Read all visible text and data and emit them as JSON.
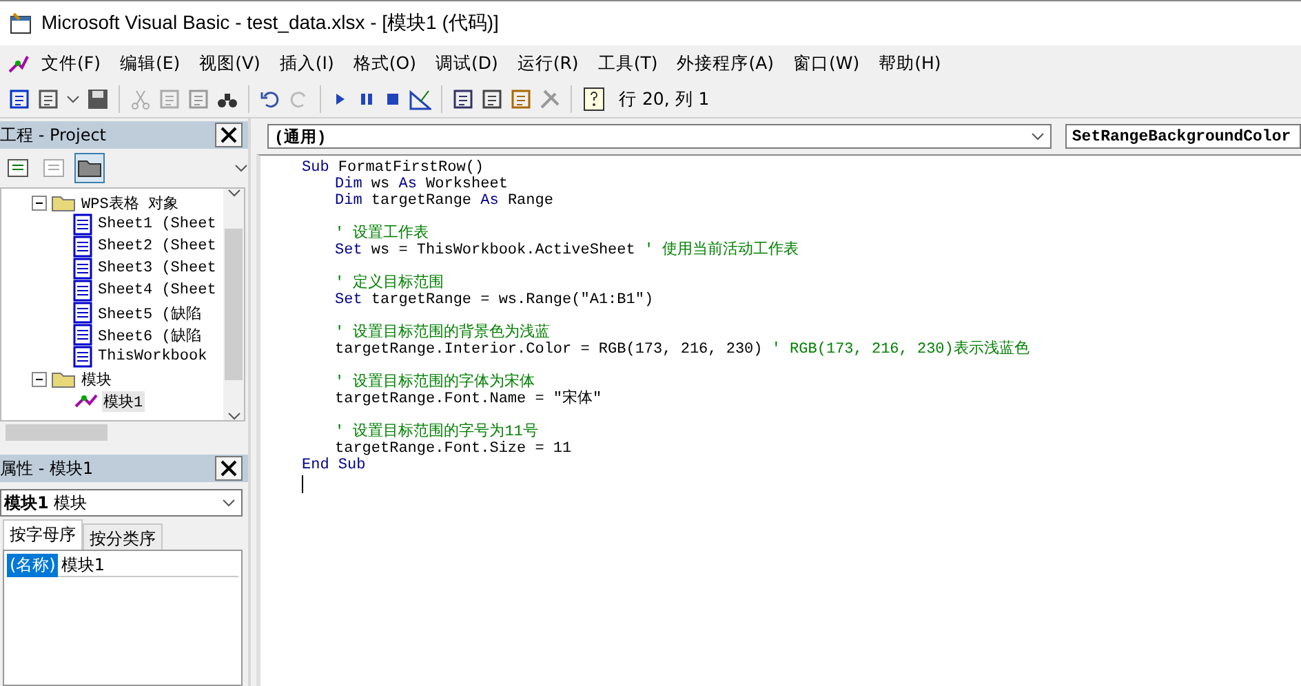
{
  "window": {
    "title": "Microsoft Visual Basic - test_data.xlsx - [模块1 (代码)]"
  },
  "menu": [
    "文件(F)",
    "编辑(E)",
    "视图(V)",
    "插入(I)",
    "格式(O)",
    "调试(D)",
    "运行(R)",
    "工具(T)",
    "外接程序(A)",
    "窗口(W)",
    "帮助(H)"
  ],
  "toolbar": {
    "position": "行 20, 列 1"
  },
  "project": {
    "title": "工程 - Project",
    "tree": [
      {
        "kind": "folder",
        "label": "WPS表格 对象",
        "expanded": true,
        "selected": false,
        "children": [
          {
            "kind": "sheet",
            "label": "Sheet1 (Sheet",
            "selected": false
          },
          {
            "kind": "sheet",
            "label": "Sheet2 (Sheet",
            "selected": false
          },
          {
            "kind": "sheet",
            "label": "Sheet3 (Sheet",
            "selected": false
          },
          {
            "kind": "sheet",
            "label": "Sheet4 (Sheet",
            "selected": false
          },
          {
            "kind": "sheet",
            "label": "Sheet5 (缺陷",
            "selected": false
          },
          {
            "kind": "sheet",
            "label": "Sheet6 (缺陷",
            "selected": false
          },
          {
            "kind": "sheet",
            "label": "ThisWorkbook",
            "selected": false
          }
        ]
      },
      {
        "kind": "folder",
        "label": "模块",
        "expanded": true,
        "selected": false,
        "children": [
          {
            "kind": "module",
            "label": "模块1",
            "selected": true
          }
        ]
      }
    ]
  },
  "properties": {
    "title": "属性 - 模块1",
    "object": "**模块1** 模块",
    "tabs": [
      {
        "label": "按字母序",
        "selected": true
      },
      {
        "label": "按分类序",
        "selected": false
      }
    ],
    "rows": [
      {
        "name": "(名称)",
        "value": "模块1",
        "selected": true
      }
    ]
  },
  "editor": {
    "object": "(通用)",
    "procedure": "SetRangeBackgroundColor",
    "lines": [
      {
        "indented": false,
        "gap_before": false,
        "segments": [
          {
            "kind": "keyword",
            "text": "Sub"
          },
          {
            "kind": "plain",
            "text": " FormatFirstRow()"
          }
        ]
      },
      {
        "indented": true,
        "gap_before": false,
        "segments": [
          {
            "kind": "keyword",
            "text": "Dim"
          },
          {
            "kind": "plain",
            "text": " ws "
          },
          {
            "kind": "keyword",
            "text": "As"
          },
          {
            "kind": "plain",
            "text": " Worksheet"
          }
        ]
      },
      {
        "indented": true,
        "gap_before": false,
        "segments": [
          {
            "kind": "keyword",
            "text": "Dim"
          },
          {
            "kind": "plain",
            "text": " targetRange "
          },
          {
            "kind": "keyword",
            "text": "As"
          },
          {
            "kind": "plain",
            "text": " Range"
          }
        ]
      },
      {
        "indented": true,
        "gap_before": true,
        "segments": [
          {
            "kind": "comment",
            "text": "' 设置工作表"
          }
        ]
      },
      {
        "indented": true,
        "gap_before": false,
        "segments": [
          {
            "kind": "keyword",
            "text": "Set"
          },
          {
            "kind": "plain",
            "text": " ws = ThisWorkbook.ActiveSheet "
          },
          {
            "kind": "comment",
            "text": "' 使用当前活动工作表"
          }
        ]
      },
      {
        "indented": true,
        "gap_before": true,
        "segments": [
          {
            "kind": "comment",
            "text": "' 定义目标范围"
          }
        ]
      },
      {
        "indented": true,
        "gap_before": false,
        "segments": [
          {
            "kind": "keyword",
            "text": "Set"
          },
          {
            "kind": "plain",
            "text": " targetRange = ws.Range(\"A1:B1\")"
          }
        ]
      },
      {
        "indented": true,
        "gap_before": true,
        "segments": [
          {
            "kind": "comment",
            "text": "' 设置目标范围的背景色为浅蓝"
          }
        ]
      },
      {
        "indented": true,
        "gap_before": false,
        "segments": [
          {
            "kind": "plain",
            "text": "targetRange.Interior.Color = RGB(173, 216, 230) "
          },
          {
            "kind": "comment",
            "text": "' RGB(173, 216, 230)表示浅蓝色"
          }
        ]
      },
      {
        "indented": true,
        "gap_before": true,
        "segments": [
          {
            "kind": "comment",
            "text": "' 设置目标范围的字体为宋体"
          }
        ]
      },
      {
        "indented": true,
        "gap_before": false,
        "segments": [
          {
            "kind": "plain",
            "text": "targetRange.Font.Name = \"宋体\""
          }
        ]
      },
      {
        "indented": true,
        "gap_before": true,
        "segments": [
          {
            "kind": "comment",
            "text": "' 设置目标范围的字号为11号"
          }
        ]
      },
      {
        "indented": true,
        "gap_before": false,
        "segments": [
          {
            "kind": "plain",
            "text": "targetRange.Font.Size = 11"
          }
        ]
      },
      {
        "indented": false,
        "gap_before": false,
        "segments": [
          {
            "kind": "keyword",
            "text": "End Sub"
          }
        ]
      }
    ]
  }
}
